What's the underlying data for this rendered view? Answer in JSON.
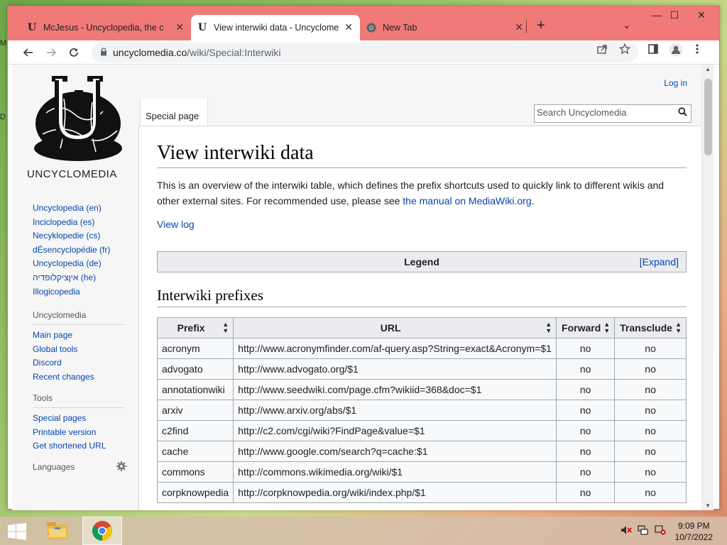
{
  "desktop": {
    "left_labels": [
      "M",
      "D"
    ]
  },
  "browser": {
    "tabs": [
      {
        "title": "McJesus - Uncyclopedia, the con",
        "favicon": "U",
        "active": false
      },
      {
        "title": "View interwiki data - Uncyclome",
        "favicon": "U",
        "active": true
      },
      {
        "title": "New Tab",
        "favicon": "chrome-icon",
        "active": false
      }
    ],
    "tab_close_glyph": "✕",
    "new_tab_glyph": "+",
    "tab_search_glyph": "⌄",
    "window_controls": {
      "minimize": "—",
      "maximize": "☐",
      "close": "✕"
    },
    "address": {
      "host": "uncyclomedia.co",
      "path": "/wiki/Special:Interwiki"
    }
  },
  "wiki": {
    "logo_text": "UNCYCLOMEDIA",
    "login": "Log in",
    "tab_special": "Special page",
    "search_placeholder": "Search Uncyclomedia",
    "languages": [
      "Uncyclopedia (en)",
      "Inciclopedia (es)",
      "Necyklopedie (cs)",
      "dÉsencyclopédie (fr)",
      "Uncyclopedia (de)",
      "איןציקלופדיה (he)",
      "Illogicopedia"
    ],
    "nav_heading": "Uncyclomedia",
    "nav_links": [
      "Main page",
      "Global tools",
      "Discord",
      "Recent changes"
    ],
    "tools_heading": "Tools",
    "tools_links": [
      "Special pages",
      "Printable version",
      "Get shortened URL"
    ],
    "languages_heading": "Languages",
    "page_title": "View interwiki data",
    "intro_text": "This is an overview of the interwiki table, which defines the prefix shortcuts used to quickly link to different wikis and other external sites. For recommended use, please see ",
    "intro_link": "the manual on MediaWiki.org",
    "intro_end": ".",
    "view_log": "View log",
    "legend_title": "Legend",
    "legend_expand": "[Expand]",
    "prefixes_heading": "Interwiki prefixes",
    "table": {
      "headers": [
        "Prefix",
        "URL",
        "Forward",
        "Transclude"
      ],
      "rows": [
        [
          "acronym",
          "http://www.acronymfinder.com/af-query.asp?String=exact&Acronym=$1",
          "no",
          "no"
        ],
        [
          "advogato",
          "http://www.advogato.org/$1",
          "no",
          "no"
        ],
        [
          "annotationwiki",
          "http://www.seedwiki.com/page.cfm?wikiid=368&doc=$1",
          "no",
          "no"
        ],
        [
          "arxiv",
          "http://www.arxiv.org/abs/$1",
          "no",
          "no"
        ],
        [
          "c2find",
          "http://c2.com/cgi/wiki?FindPage&value=$1",
          "no",
          "no"
        ],
        [
          "cache",
          "http://www.google.com/search?q=cache:$1",
          "no",
          "no"
        ],
        [
          "commons",
          "http://commons.wikimedia.org/wiki/$1",
          "no",
          "no"
        ],
        [
          "corpknowpedia",
          "http://corpknowpedia.org/wiki/index.php/$1",
          "no",
          "no"
        ]
      ]
    }
  },
  "taskbar": {
    "time": "9:09 PM",
    "date": "10/7/2022"
  },
  "colors": {
    "link": "#0645ad",
    "tabstrip": "#ef7a78",
    "table_header": "#eaecf0"
  }
}
